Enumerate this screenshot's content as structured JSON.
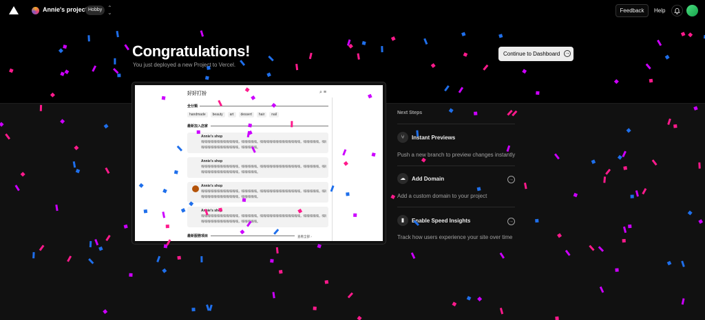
{
  "topbar": {
    "team_name": "Annie's projects",
    "plan_badge": "Hobby",
    "feedback_label": "Feedback",
    "help_label": "Help"
  },
  "hero": {
    "title": "Congratulations!",
    "subtitle": "You just deployed a new Project to Vercel.",
    "dashboard_button": "Continue to Dashboard"
  },
  "preview": {
    "header": "好好打扮",
    "section_categories": "全分類",
    "tags": [
      "handmade",
      "beauty",
      "art",
      "dessert",
      "hair",
      "nail"
    ],
    "section_new_shops": "最新加入店家",
    "cards": [
      {
        "shop": "Annie's shop",
        "line1": "嗨嗨嗨嗨嗨嗨嗨嗨嗨嗨嗨嗨，嗨嗨嗨嗨嗨。嗨嗨嗨嗨嗨嗨嗨嗨嗨嗨嗨嗨嗨，嗨嗨嗨嗨嗨，嗨嗨",
        "line2": "嗨嗨嗨嗨嗨嗨嗨嗨嗨嗨嗨嗨，嗨嗨嗨嗨嗨。"
      },
      {
        "shop": "Annie's shop",
        "line1": "嗨嗨嗨嗨嗨嗨嗨嗨嗨嗨嗨嗨，嗨嗨嗨嗨嗨。嗨嗨嗨嗨嗨嗨嗨嗨嗨嗨嗨嗨嗨，嗨嗨嗨嗨嗨，嗨嗨",
        "line2": "嗨嗨嗨嗨嗨嗨嗨嗨嗨嗨嗨嗨，嗨嗨嗨嗨嗨。"
      },
      {
        "shop": "Annie's shop",
        "line1": "嗨嗨嗨嗨嗨嗨嗨嗨嗨嗨嗨嗨，嗨嗨嗨嗨嗨。嗨嗨嗨嗨嗨嗨嗨嗨嗨嗨嗨嗨嗨，嗨嗨嗨嗨嗨，嗨嗨",
        "line2": "嗨嗨嗨嗨嗨嗨嗨嗨嗨嗨嗨嗨，嗨嗨嗨嗨嗨。"
      },
      {
        "shop": "Annie's shop",
        "line1": "嗨嗨嗨嗨嗨嗨嗨嗨嗨嗨嗨嗨，嗨嗨嗨嗨嗨。嗨嗨嗨嗨嗨嗨嗨嗨嗨嗨嗨嗨嗨，嗨嗨嗨嗨嗨，嗨嗨",
        "line2": "嗨嗨嗨嗨嗨嗨嗨嗨嗨嗨嗨嗨，嗨嗨嗨嗨嗨。"
      }
    ],
    "section_services": "最新服務項目",
    "more_link": "查看全部 ›"
  },
  "next_steps": {
    "title": "Next Steps",
    "items": [
      {
        "label": "Instant Previews",
        "desc": "Push a new branch to preview changes instantly",
        "icon": "branch-icon"
      },
      {
        "label": "Add Domain",
        "desc": "Add a custom domain to your project",
        "icon": "cloud-icon"
      },
      {
        "label": "Enable Speed Insights",
        "desc": "Track how users experience your site over time",
        "icon": "bar-chart-icon"
      }
    ]
  },
  "colors": {
    "confetti": [
      "#1f6feb",
      "#ff1a8c",
      "#cc00ff"
    ]
  }
}
